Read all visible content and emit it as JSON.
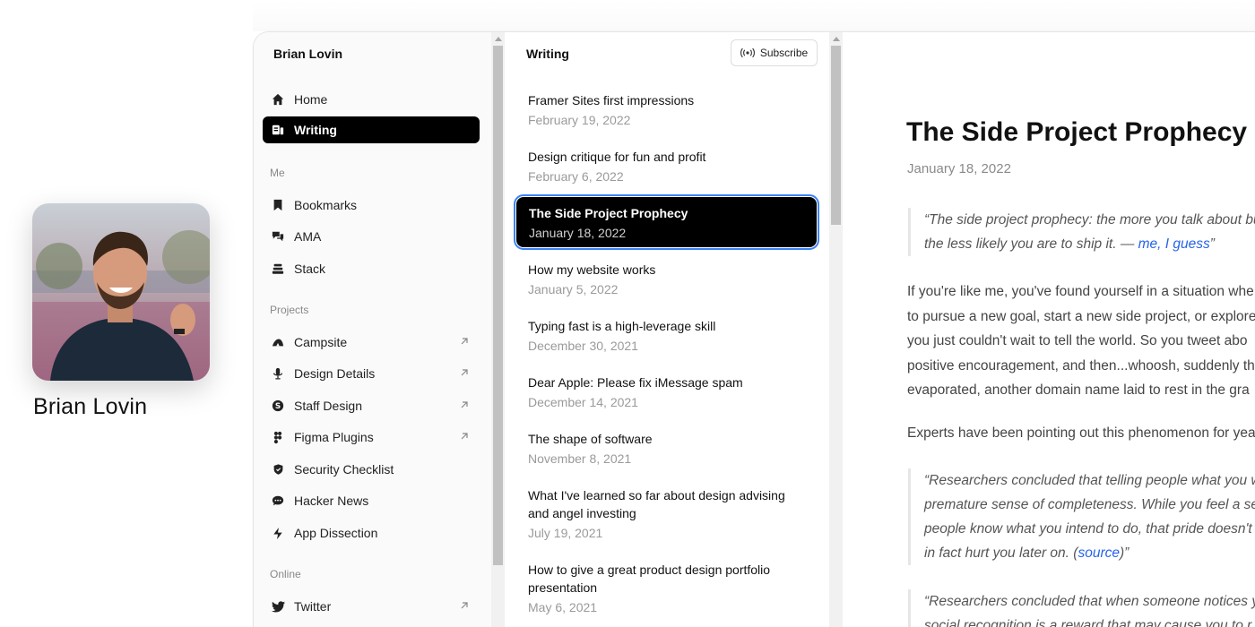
{
  "profile": {
    "name": "Brian Lovin"
  },
  "sidebar": {
    "title": "Brian Lovin",
    "primary": [
      {
        "label": "Home",
        "icon": "home-icon"
      },
      {
        "label": "Writing",
        "icon": "writing-icon",
        "active": true
      }
    ],
    "sections": [
      {
        "label": "Me",
        "items": [
          {
            "label": "Bookmarks",
            "icon": "bookmark-icon"
          },
          {
            "label": "AMA",
            "icon": "chat-bubbles-icon"
          },
          {
            "label": "Stack",
            "icon": "stack-icon"
          }
        ]
      },
      {
        "label": "Projects",
        "items": [
          {
            "label": "Campsite",
            "icon": "campsite-icon",
            "external": true
          },
          {
            "label": "Design Details",
            "icon": "microphone-icon",
            "external": true
          },
          {
            "label": "Staff Design",
            "icon": "staff-design-icon",
            "external": true
          },
          {
            "label": "Figma Plugins",
            "icon": "figma-icon",
            "external": true
          },
          {
            "label": "Security Checklist",
            "icon": "shield-icon"
          },
          {
            "label": "Hacker News",
            "icon": "comment-icon"
          },
          {
            "label": "App Dissection",
            "icon": "bolt-icon"
          }
        ]
      },
      {
        "label": "Online",
        "items": [
          {
            "label": "Twitter",
            "icon": "twitter-icon",
            "external": true
          }
        ]
      }
    ]
  },
  "list": {
    "title": "Writing",
    "subscribe_label": "Subscribe",
    "posts": [
      {
        "title": "Framer Sites first impressions",
        "date": "February 19, 2022"
      },
      {
        "title": "Design critique for fun and profit",
        "date": "February 6, 2022"
      },
      {
        "title": "The Side Project Prophecy",
        "date": "January 18, 2022",
        "active": true
      },
      {
        "title": "How my website works",
        "date": "January 5, 2022"
      },
      {
        "title": "Typing fast is a high-leverage skill",
        "date": "December 30, 2021"
      },
      {
        "title": "Dear Apple: Please fix iMessage spam",
        "date": "December 14, 2021"
      },
      {
        "title": "The shape of software",
        "date": "November 8, 2021"
      },
      {
        "title": "What I've learned so far about design advising and angel investing",
        "date": "July 19, 2021"
      },
      {
        "title": "How to give a great product design portfolio presentation",
        "date": "May 6, 2021"
      }
    ]
  },
  "article": {
    "title": "The Side Project Prophecy",
    "date": "January 18, 2022",
    "quote1": {
      "line1": "“The side project prophecy: the more you talk about bu",
      "line2_pre": "the less likely you are to ship it. — ",
      "line2_link": "me, I guess",
      "line2_post": "”"
    },
    "para1": [
      "If you're like me, you've found yourself in a situation whe",
      "to pursue a new goal, start a new side project, or explore",
      "you just couldn't wait to tell the world. So you tweet abo",
      "positive encouragement, and then...whoosh, suddenly th",
      "evaporated, another domain name laid to rest in the gra"
    ],
    "para2": "Experts have been pointing out this phenomenon for yea",
    "quote2": {
      "line1": "“Researchers concluded that telling people what you w",
      "line2": "premature sense of completeness. While you feel a sens",
      "line3": "people know what you intend to do, that pride doesn't",
      "line4_pre": "in fact hurt you later on. (",
      "line4_link": "source",
      "line4_post": ")”"
    },
    "quote3": {
      "line1": "“Researchers concluded that when someone notices you",
      "line2": "social recognition is a reward that may cause you to r"
    }
  }
}
